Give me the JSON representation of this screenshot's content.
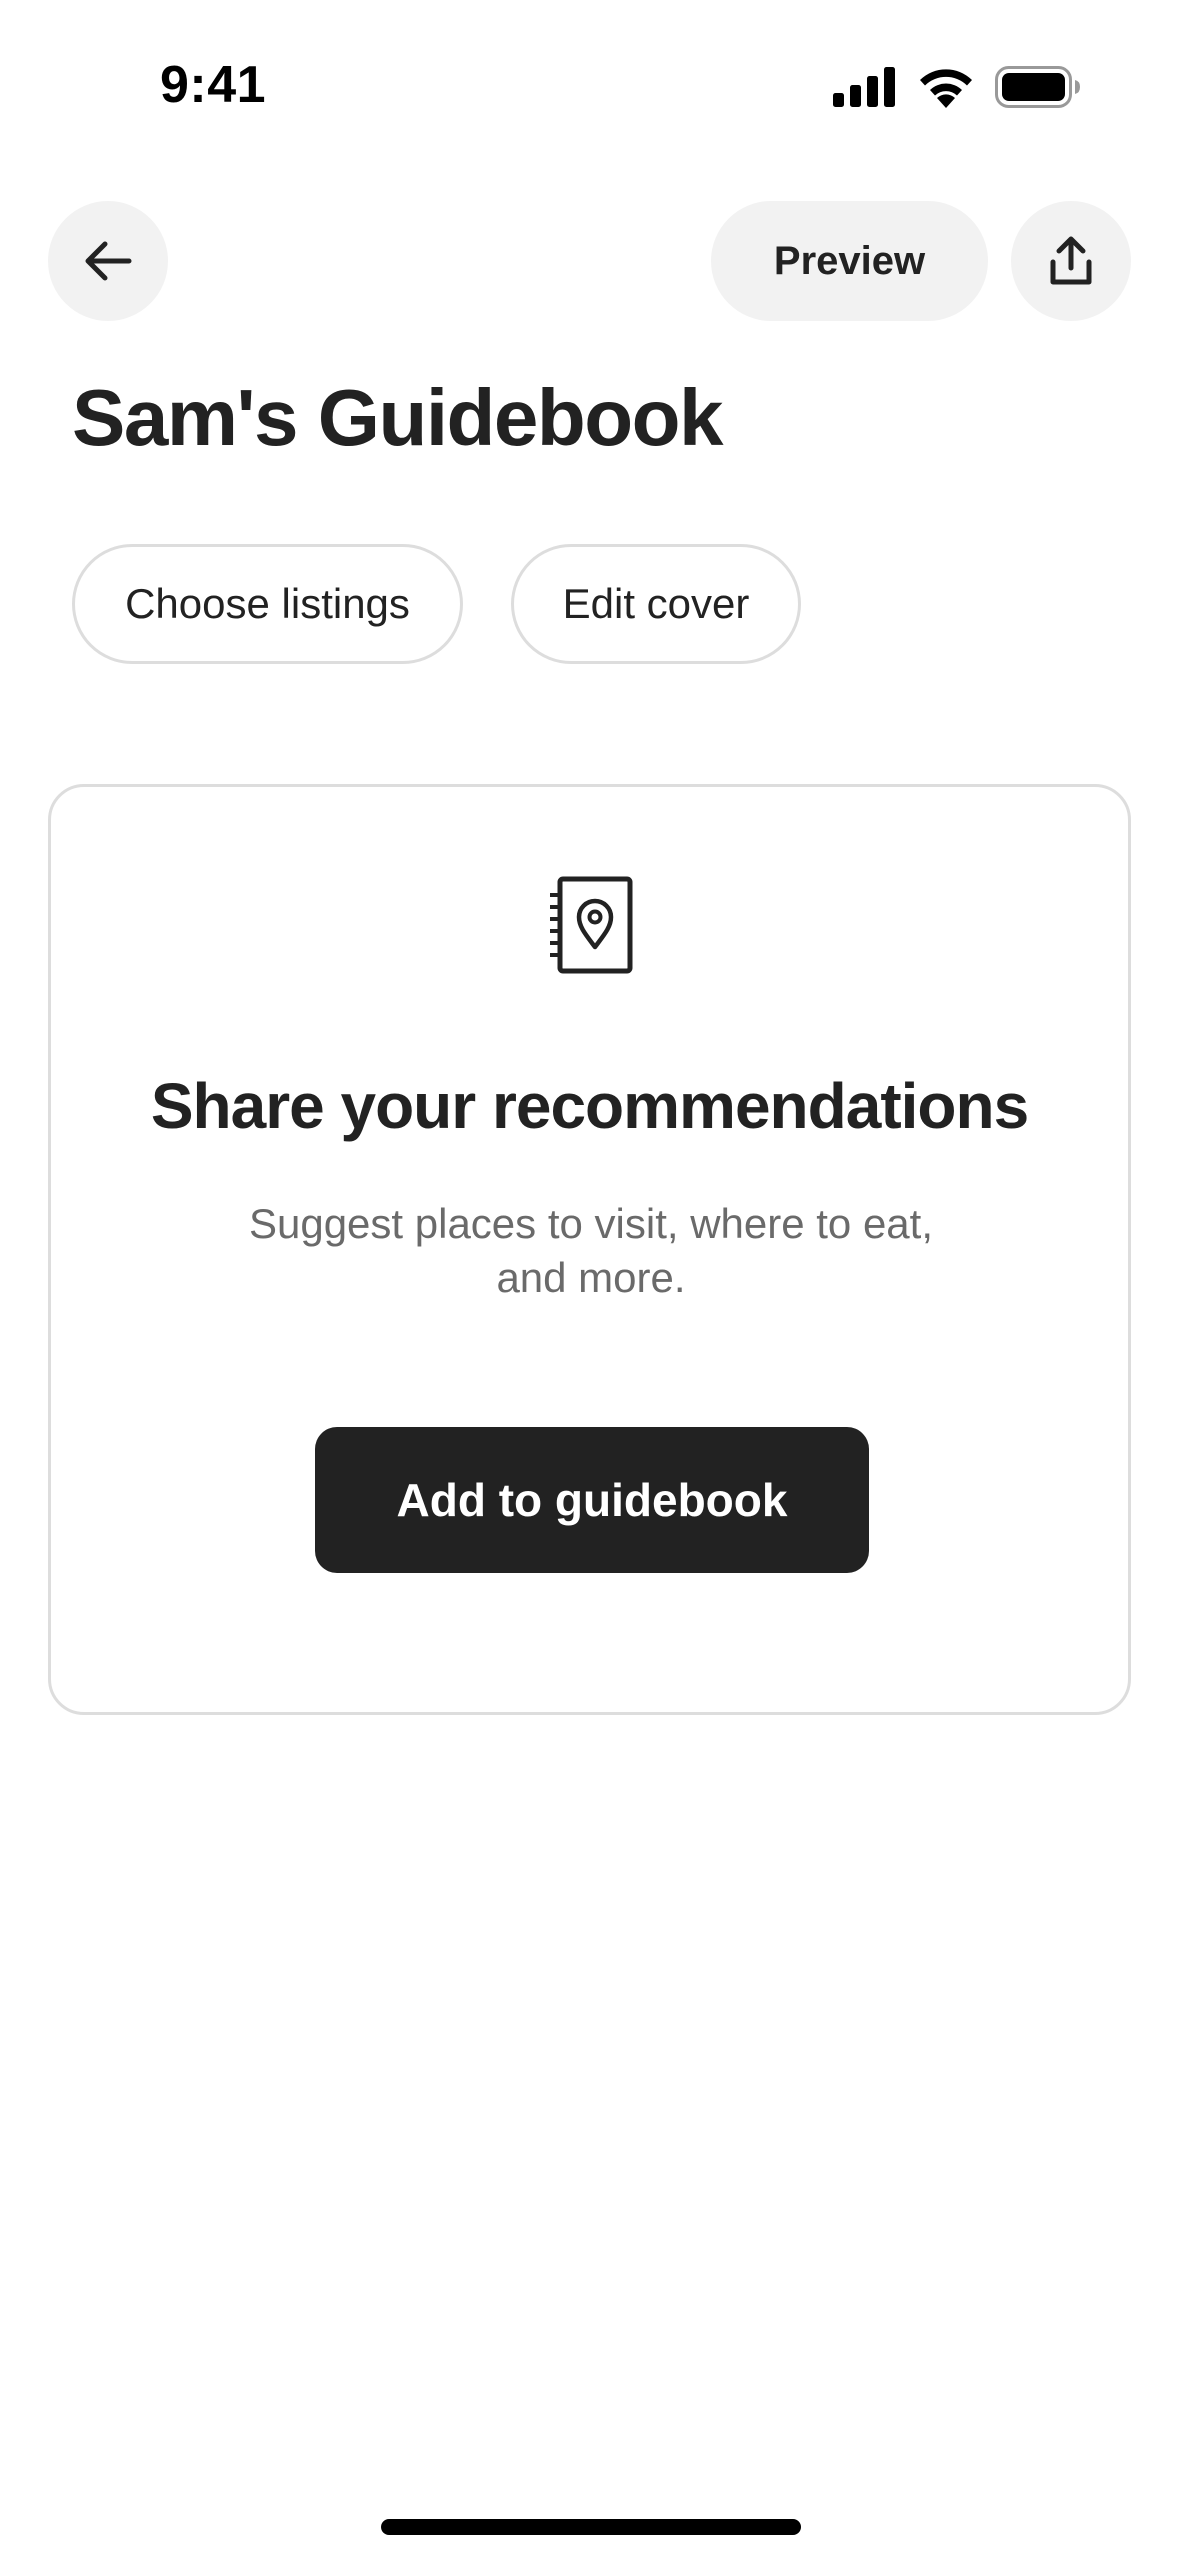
{
  "status_bar": {
    "time": "9:41",
    "icons": [
      "cellular-signal-icon",
      "wifi-icon",
      "battery-icon"
    ]
  },
  "header": {
    "back_icon": "arrow-left-icon",
    "preview_label": "Preview",
    "share_icon": "share-upload-icon"
  },
  "page": {
    "title": "Sam's Guidebook"
  },
  "actions": {
    "choose_listings": "Choose listings",
    "edit_cover": "Edit cover"
  },
  "empty_state": {
    "icon": "guidebook-location-icon",
    "title": "Share your recommendations",
    "description": "Suggest places to visit, where to eat, and more.",
    "button_label": "Add to guidebook"
  },
  "colors": {
    "primary_button": "#222222",
    "muted_text": "#6a6a6a",
    "border": "#dddddd",
    "chip_background": "#f2f2f2"
  }
}
